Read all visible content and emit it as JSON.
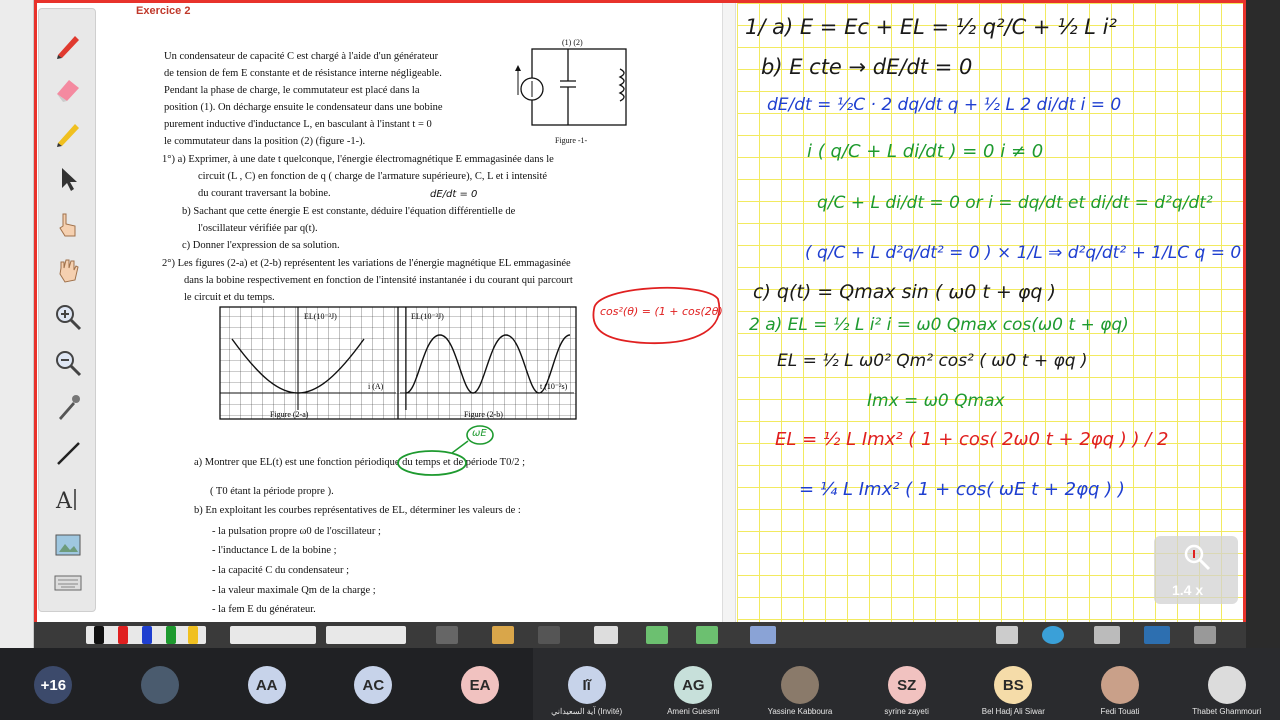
{
  "exercise": {
    "title": "Exercice 2",
    "intro": [
      "Un condensateur de capacité C est chargé à l'aide d'un générateur",
      "de tension de fem E constante et de résistance interne négligeable.",
      "Pendant la phase de charge, le commutateur est placé dans la",
      "position (1). On décharge ensuite le condensateur dans une bobine",
      "purement inductive d'inductance L, en basculant à l'instant t = 0",
      "le commutateur dans la position (2) (figure -1-)."
    ],
    "q1": "1°) a) Exprimer, à une date t quelconque, l'énergie électromagnétique E emmagasinée dans le",
    "q1_cont": [
      "circuit (L , C) en fonction de q ( charge de l'armature supérieure), C, L et i intensité",
      "du courant traversant la bobine."
    ],
    "q1b": "b) Sachant que cette énergie E est constante, déduire l'équation différentielle de",
    "q1b_cont": "l'oscillateur vérifiée par q(t).",
    "q1c": "c) Donner l'expression de sa solution.",
    "q2": "2°) Les figures (2-a) et (2-b) représentent les variations de l'énergie magnétique EL emmagasinée",
    "q2_cont": [
      "dans la bobine respectivement en fonction de l'intensité instantanée i du courant qui parcourt",
      "le circuit et du temps."
    ],
    "q2a": "a) Montrer que EL(t) est une fonction périodique du temps et de période T0/2 ;",
    "q2a_note": "( T0 étant la période propre ).",
    "q2b": "b) En exploitant les courbes représentatives de EL, déterminer les valeurs de :",
    "list": [
      "- la pulsation propre ω0 de l'oscillateur ;",
      "- l'inductance L de la bobine ;",
      "- la capacité C du condensateur ;",
      "- la valeur maximale Qm de la charge ;",
      "- la fem E du générateur."
    ],
    "figure1_label": "Figure -1-",
    "figure1_pos": "(1) (2)",
    "fig2a_label": "Figure (2-a)",
    "fig2b_label": "Figure (2-b)",
    "fig2a_ylabel": "EL(10⁻³J)",
    "fig2b_ylabel": "EL(10⁻³J)",
    "fig2a_xlabel": "i (A)",
    "fig2b_xlabel": "t (10⁻²s)"
  },
  "handwriting": {
    "l1": "1/ a)  E = Ec + EL = ½ q²/C + ½ L i²",
    "l2": "b)  E cte → dE/dt = 0",
    "l3": "dE/dt = ½C · 2 dq/dt q + ½ L 2 di/dt i = 0",
    "l4": "i ( q/C + L di/dt ) = 0        i ≠ 0",
    "l5": "q/C + L di/dt = 0     or  i = dq/dt  et di/dt = d²q/dt²",
    "l6": "( q/C + L d²q/dt² = 0 ) × 1/L  ⇒  d²q/dt² + 1/LC q = 0",
    "l7": "c)  q(t) = Qmax sin ( ω0 t + φq )",
    "l8": "2  a)  EL = ½ L i²        i = ω0 Qmax cos(ω0 t + φq)",
    "l9": "EL = ½ L ω0² Qm² cos² ( ω0 t + φq )",
    "l10": "Imx = ω0 Qmax",
    "l11": "EL = ½ L Imx² ( 1 + cos( 2ω0 t + 2φq ) ) / 2",
    "l12": "= ¼ L Imx² ( 1 + cos( ωE t + 2φq ) )",
    "note_red": "cos²(θ) = (1 + cos(2θ)) / 2",
    "note_we": "ωE",
    "note_de": "dE/dt = 0"
  },
  "zoom_level": "1.4 x",
  "participants": [
    {
      "initials": "+16",
      "name": "",
      "color": "#3c4a6b"
    },
    {
      "initials": "",
      "name": "",
      "color": "#4a5b6e"
    },
    {
      "initials": "AA",
      "name": "",
      "color": "#c7d3ea"
    },
    {
      "initials": "AC",
      "name": "",
      "color": "#c7d3ea"
    },
    {
      "initials": "EA",
      "name": "",
      "color": "#f1c2c0"
    },
    {
      "initials": "Iĩ",
      "name": "آية السعيداني (Invité)",
      "color": "#c7d3ea"
    },
    {
      "initials": "AG",
      "name": "Ameni Guesmi",
      "color": "#c7e0da"
    },
    {
      "initials": "",
      "name": "Yassine Kabboura",
      "color": "#8a7a6a"
    },
    {
      "initials": "SZ",
      "name": "syrine zayeti",
      "color": "#f1c2c0"
    },
    {
      "initials": "BS",
      "name": "Bel Hadj Ali Siwar",
      "color": "#f5dca9"
    },
    {
      "initials": "",
      "name": "Fedi Touati",
      "color": "#c9a089"
    },
    {
      "initials": "",
      "name": "Thabet Ghammouri",
      "color": "#dcdcdc"
    }
  ]
}
